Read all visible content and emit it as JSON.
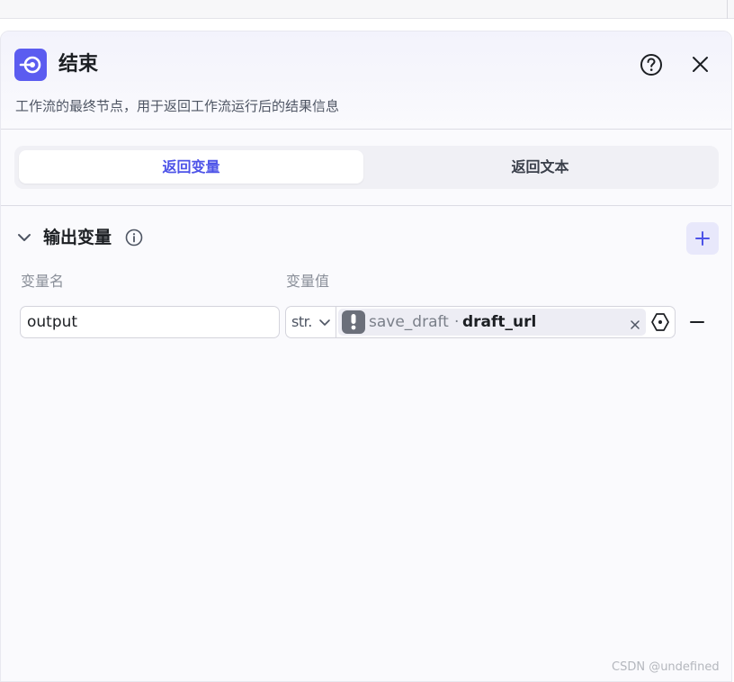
{
  "header": {
    "title": "结束",
    "description": "工作流的最终节点，用于返回工作流运行后的结果信息",
    "icon": "end-node-icon",
    "accent": "#5b5cf0"
  },
  "tabs": [
    {
      "label": "返回变量",
      "active": true
    },
    {
      "label": "返回文本",
      "active": false
    }
  ],
  "output_section": {
    "title": "输出变量",
    "columns": {
      "name": "变量名",
      "value": "变量值"
    },
    "rows": [
      {
        "name": "output",
        "type": "str.",
        "ref_node": "save_draft",
        "ref_separator": "·",
        "ref_field": "draft_url"
      }
    ]
  },
  "watermark": "CSDN @undefined",
  "colors": {
    "primary": "#4d53e8",
    "warning_icon": "#6b6f7a"
  }
}
